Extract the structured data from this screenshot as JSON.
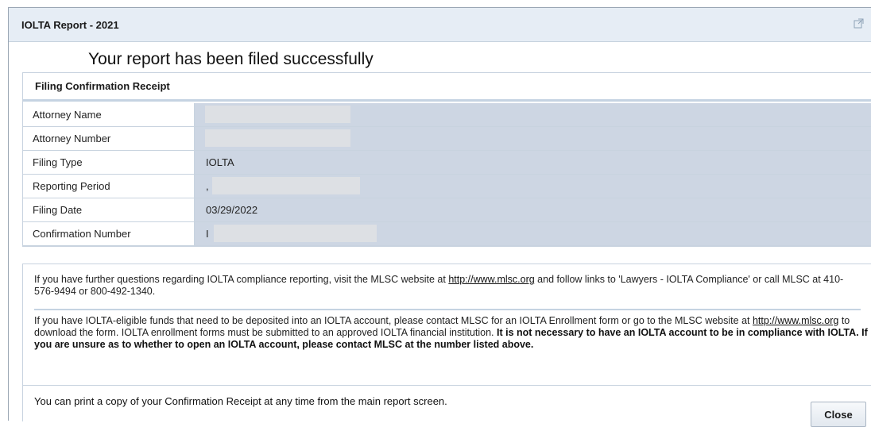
{
  "window": {
    "title": "IOLTA Report - 2021",
    "popout_icon": "popout-icon"
  },
  "success_message": "Your report has been filed successfully",
  "receipt": {
    "header": "Filing Confirmation Receipt",
    "rows": [
      {
        "label": "Attorney Name",
        "value": ""
      },
      {
        "label": "Attorney Number",
        "value": ""
      },
      {
        "label": "Filing Type",
        "value": "IOLTA"
      },
      {
        "label": "Reporting Period",
        "value": ","
      },
      {
        "label": "Filing Date",
        "value": "03/29/2022"
      },
      {
        "label": "Confirmation Number",
        "value": "I"
      }
    ]
  },
  "info": {
    "para1_before_link": "If you have further questions regarding IOLTA compliance reporting, visit the MLSC website at ",
    "para1_link": "http://www.mlsc.org",
    "para1_after_link": " and follow links to 'Lawyers - IOLTA Compliance' or call MLSC at 410-576-9494 or 800-492-1340.",
    "para2_before_link": "If you have IOLTA-eligible funds that need to be deposited into an IOLTA account, please contact MLSC for an IOLTA Enrollment form or go to the MLSC website at ",
    "para2_link": "http://www.mlsc.org",
    "para2_after_link": " to download the form. IOLTA enrollment forms must be submitted to an approved IOLTA financial institution. ",
    "para2_bold": "It is not necessary to have an IOLTA account to be in compliance with IOLTA. If you are unsure as to whether to open an IOLTA account, please contact MLSC at the number listed above."
  },
  "footer": {
    "print_note": "You can print a copy of your Confirmation Receipt at any time from the main report screen.",
    "close_label": "Close"
  }
}
